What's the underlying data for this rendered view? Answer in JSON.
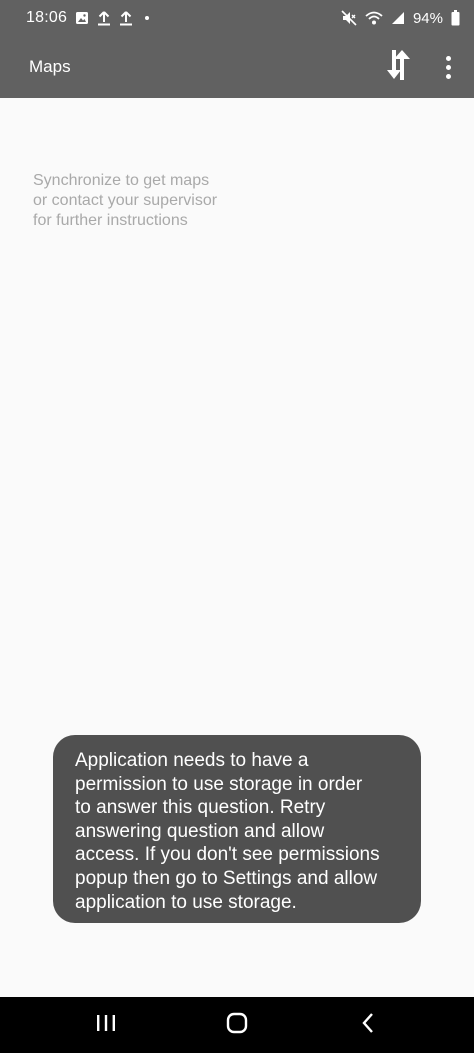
{
  "status_bar": {
    "time": "18:06",
    "battery": "94%",
    "icons": [
      "image-icon",
      "upload-icon",
      "upload-icon",
      "dot",
      "mute-icon",
      "wifi-icon",
      "signal-icon",
      "battery-icon"
    ]
  },
  "app_bar": {
    "title": "Maps",
    "icons": [
      "sync-icon",
      "more-vert-icon"
    ]
  },
  "main": {
    "empty_lines": [
      "Synchronize to get maps",
      "or contact your supervisor",
      "for further instructions"
    ]
  },
  "toast": {
    "lines": [
      "Application needs to have a",
      "permission to use storage in order",
      "to answer this question. Retry",
      "answering question and allow",
      "access. If you don't see permissions",
      "popup then go to Settings and allow",
      "application to use storage."
    ]
  },
  "nav_bar": {
    "icons": [
      "recents-icon",
      "home-icon",
      "back-icon"
    ]
  },
  "colors": {
    "app_bar": "#616161",
    "background": "#fafafa",
    "hint_text": "#a9a9a9",
    "toast_bg": "#505050",
    "nav_bg": "#000000"
  }
}
